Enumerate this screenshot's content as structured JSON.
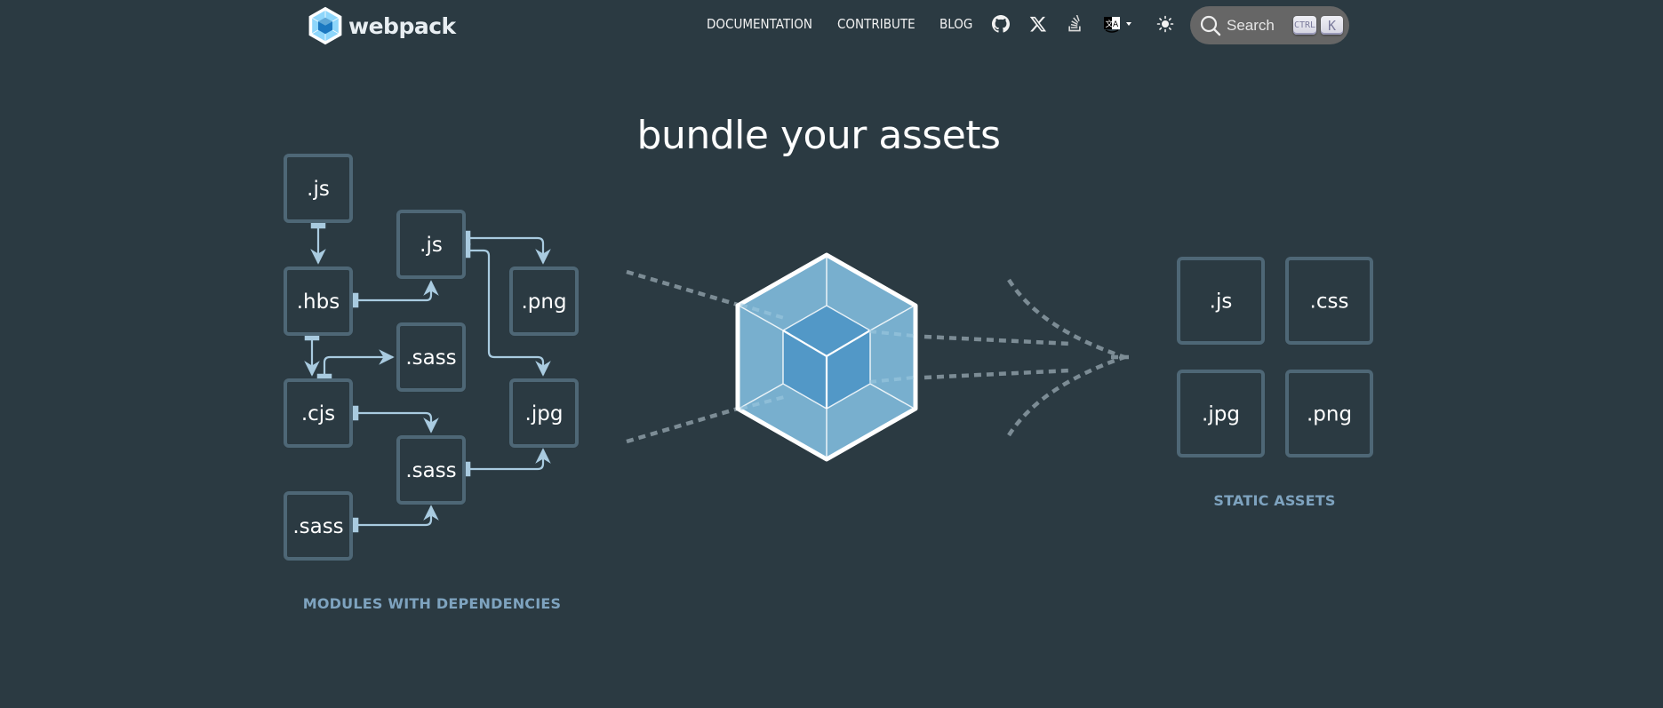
{
  "header": {
    "logo_text": "webpack",
    "nav_links": [
      {
        "label": "DOCUMENTATION"
      },
      {
        "label": "CONTRIBUTE"
      },
      {
        "label": "BLOG"
      }
    ],
    "icons": [
      "github-icon",
      "x-twitter-icon",
      "stack-overflow-icon",
      "language-icon",
      "theme-toggle-icon"
    ],
    "search": {
      "placeholder": "Search",
      "shortcut_keys": [
        "CTRL",
        "K"
      ]
    }
  },
  "hero": {
    "title": "bundle your assets"
  },
  "diagram": {
    "modules": {
      "caption": "MODULES WITH DEPENDENCIES",
      "boxes": [
        ".js",
        ".js",
        ".hbs",
        ".png",
        ".sass",
        ".cjs",
        ".jpg",
        ".sass",
        ".sass"
      ]
    },
    "assets": {
      "caption": "STATIC ASSETS",
      "boxes": [
        ".js",
        ".css",
        ".jpg",
        ".png"
      ]
    },
    "colors": {
      "background": "#2b3a42",
      "box_border": "#4e6776",
      "arrow": "#a9cbe0",
      "cube_outer": "#78afce",
      "cube_inner": "#5298c7",
      "dash": "#7c8c95",
      "caption": "#7ea3bf"
    }
  }
}
